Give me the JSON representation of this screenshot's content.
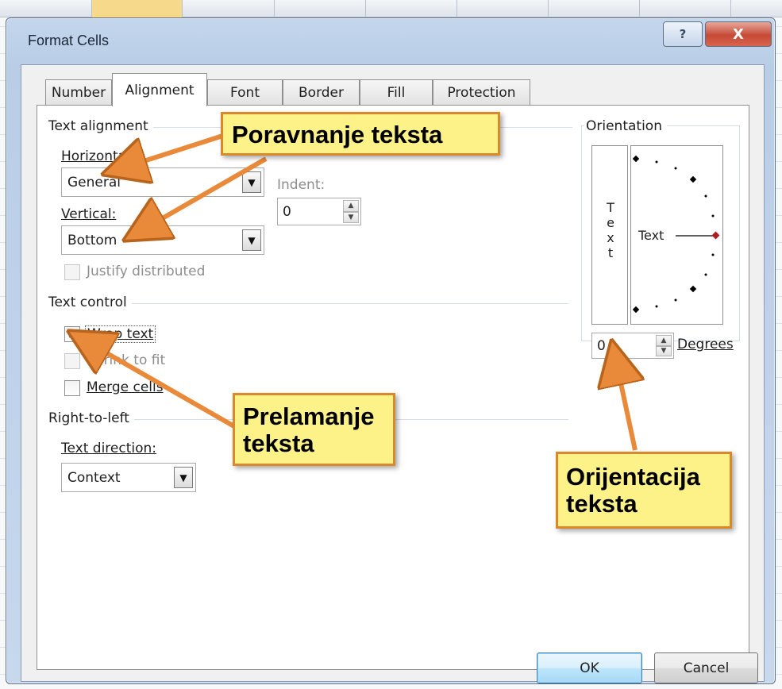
{
  "window": {
    "title": "Format Cells",
    "help_glyph": "?",
    "close_glyph": "X"
  },
  "tabs": [
    {
      "label": "Number",
      "active": false
    },
    {
      "label": "Alignment",
      "active": true
    },
    {
      "label": "Font",
      "active": false
    },
    {
      "label": "Border",
      "active": false
    },
    {
      "label": "Fill",
      "active": false
    },
    {
      "label": "Protection",
      "active": false
    }
  ],
  "text_alignment": {
    "group_label": "Text alignment",
    "horizontal_label": "Horizontal:",
    "horizontal_value": "General",
    "vertical_label": "Vertical:",
    "vertical_value": "Bottom",
    "indent_label": "Indent:",
    "indent_value": "0",
    "justify_distributed_label": "Justify distributed",
    "justify_distributed_checked": false
  },
  "text_control": {
    "group_label": "Text control",
    "wrap_text_label": "Wrap text",
    "wrap_text_checked": true,
    "shrink_to_fit_label": "Shrink to fit",
    "shrink_to_fit_checked": false,
    "merge_cells_label": "Merge cells",
    "merge_cells_checked": false
  },
  "right_to_left": {
    "group_label": "Right-to-left",
    "text_direction_label": "Text direction:",
    "text_direction_value": "Context"
  },
  "orientation": {
    "group_label": "Orientation",
    "vertical_text": [
      "T",
      "e",
      "x",
      "t"
    ],
    "dial_text": "Text",
    "degrees_value": "0",
    "degrees_label": "Degrees"
  },
  "buttons": {
    "ok_label": "OK",
    "cancel_label": "Cancel"
  },
  "annotations": {
    "callout_alignment": "Poravnanje teksta",
    "callout_wrap_line1": "Prelamanje",
    "callout_wrap_line2": "teksta",
    "callout_orientation_line1": "Orijentacija",
    "callout_orientation_line2": "teksta"
  },
  "colors": {
    "callout_fill": "#fdf287",
    "callout_border": "#d9892c",
    "arrow": "#e98a3a",
    "dial_marker": "#b02020",
    "checkbox_check": "#2149a6"
  }
}
